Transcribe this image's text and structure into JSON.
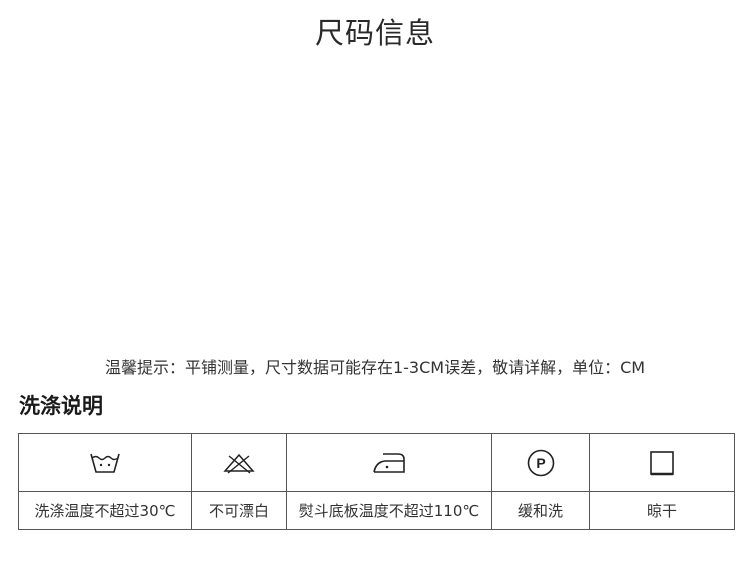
{
  "header": {
    "title": "尺码信息"
  },
  "notice": {
    "text": "温馨提示：平铺测量，尺寸数据可能存在1-3CM误差，敬请详解，单位：CM"
  },
  "care": {
    "title": "洗涤说明",
    "items": [
      {
        "icon": "wash-30-icon",
        "label": "洗涤温度不超过30℃"
      },
      {
        "icon": "no-bleach-icon",
        "label": "不可漂白"
      },
      {
        "icon": "iron-icon",
        "label": "熨斗底板温度不超过110℃"
      },
      {
        "icon": "dry-clean-p-icon",
        "label": "缓和洗",
        "symbol": "P"
      },
      {
        "icon": "tumble-dry-square-icon",
        "label": "晾干"
      }
    ]
  }
}
